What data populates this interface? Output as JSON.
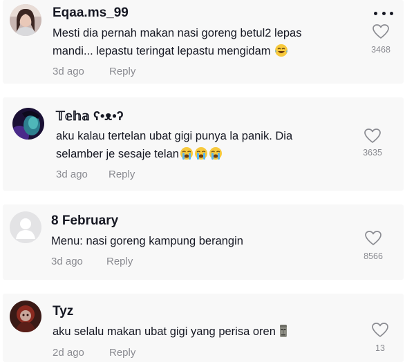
{
  "comments": [
    {
      "username": "Eqaa.ms_99",
      "line1": "Mesti dia pernah makan nasi goreng betul2 lepas",
      "line2": "mandi... lepastu teringat lepastu mengidam",
      "time": "3d ago",
      "reply": "Reply",
      "likes": "3468",
      "emoji": [
        "laughing-tears"
      ]
    },
    {
      "username": "𝕋𝕖𝕙𝕒 ʕ•ᴥ•ʔ",
      "line1": "aku kalau tertelan ubat gigi punya la panik. Dia",
      "line2": "selamber je sesaje telan",
      "time": "3d ago",
      "reply": "Reply",
      "likes": "3635",
      "emoji": [
        "crying",
        "crying",
        "crying"
      ]
    },
    {
      "username": "8 February",
      "line1": "Menu: nasi goreng kampung berangin",
      "time": "3d ago",
      "reply": "Reply",
      "likes": "8566"
    },
    {
      "username": "Tyz",
      "line1": "aku selalu makan ubat gigi yang perisa oren",
      "time": "2d ago",
      "reply": "Reply",
      "likes": "13",
      "emoji": [
        "moai"
      ]
    }
  ],
  "icons": {
    "like": "heart-outline-icon",
    "more": "more-options-icon"
  },
  "colors": {
    "text": "#161823",
    "muted": "#8a8b91",
    "card": "#f8f8f8"
  }
}
